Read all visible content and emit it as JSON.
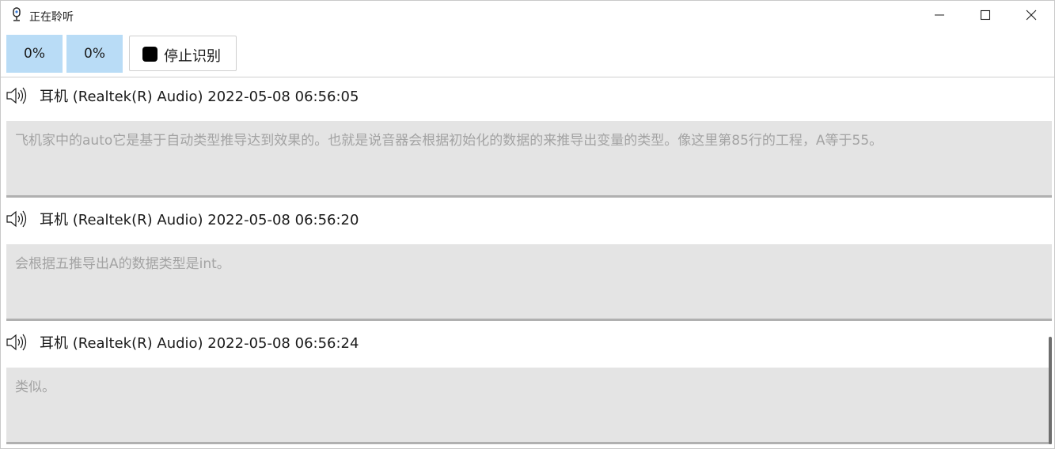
{
  "window": {
    "title": "正在聆听",
    "icon": "microphone-icon",
    "controls": [
      "minimize-icon",
      "maximize-icon",
      "close-icon"
    ]
  },
  "toolbar": {
    "level_a": "0%",
    "level_b": "0%",
    "stop_label": "停止识别",
    "colors": {
      "level_bg": "#b9dcf6"
    }
  },
  "transcripts": [
    {
      "source": "耳机 (Realtek(R) Audio) 2022-05-08 06:56:05",
      "text": "飞机家中的auto它是基于自动类型推导达到效果的。也就是说音器会根据初始化的数据的来推导出变量的类型。像这里第85行的工程，A等于55。"
    },
    {
      "source": "耳机 (Realtek(R) Audio) 2022-05-08 06:56:20",
      "text": "会根据五推导出A的数据类型是int。"
    },
    {
      "source": "耳机 (Realtek(R) Audio) 2022-05-08 06:56:24",
      "text": "类似。"
    }
  ]
}
